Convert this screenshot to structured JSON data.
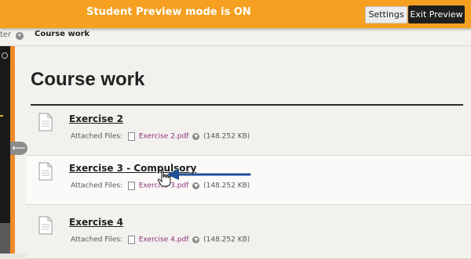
{
  "banner": {
    "text": "Student Preview mode is ON",
    "settings_label": "Settings",
    "exit_label": "Exit Preview",
    "color": "#f5a020"
  },
  "breadcrumb": {
    "previous": "ter",
    "current": "Course work"
  },
  "collapse_glyph": "⟵",
  "page": {
    "title": "Course work"
  },
  "items": [
    {
      "title": "Exercise 2",
      "files_label": "Attached Files:",
      "file_name": "Exercise 2.pdf",
      "file_size": "(148.252 KB)"
    },
    {
      "title": "Exercise 3 - Compulsory",
      "files_label": "Attached Files:",
      "file_name": "Exercise 3.pdf",
      "file_size": "(148.252 KB)"
    },
    {
      "title": "Exercise 4",
      "files_label": "Attached Files:",
      "file_name": "Exercise 4.pdf",
      "file_size": "(148.252 KB)"
    }
  ],
  "annotation_color": "#1f4e96",
  "link_color": "#8b2f7a"
}
